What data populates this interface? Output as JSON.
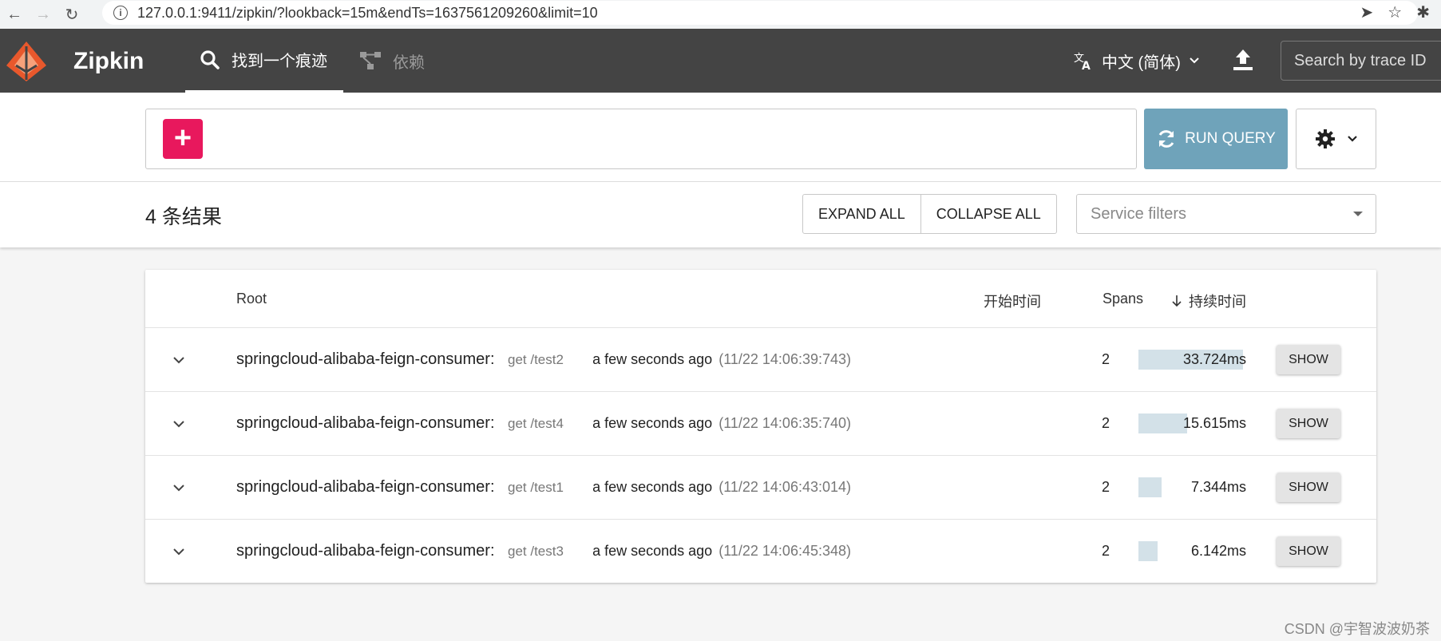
{
  "browser": {
    "url": "127.0.0.1:9411/zipkin/?lookback=15m&endTs=1637561209260&limit=10"
  },
  "header": {
    "brand": "Zipkin",
    "tab_find": "找到一个痕迹",
    "tab_dependencies": "依赖",
    "language": "中文 (简体)",
    "trace_search_placeholder": "Search by trace ID"
  },
  "query": {
    "run_label": "RUN QUERY"
  },
  "results": {
    "count_label": "4 条结果",
    "expand_all": "EXPAND ALL",
    "collapse_all": "COLLAPSE ALL",
    "service_filters_placeholder": "Service filters"
  },
  "table": {
    "columns": {
      "root": "Root",
      "start_time": "开始时间",
      "spans": "Spans",
      "duration": "持续时间"
    },
    "show_label": "SHOW",
    "rows": [
      {
        "service": "springcloud-alibaba-feign-consumer:",
        "operation": "get /test2",
        "ago": "a few seconds ago",
        "timestamp": "(11/22 14:06:39:743)",
        "spans": "2",
        "duration": "33.724ms",
        "duration_fraction": 1.0
      },
      {
        "service": "springcloud-alibaba-feign-consumer:",
        "operation": "get /test4",
        "ago": "a few seconds ago",
        "timestamp": "(11/22 14:06:35:740)",
        "spans": "2",
        "duration": "15.615ms",
        "duration_fraction": 0.463
      },
      {
        "service": "springcloud-alibaba-feign-consumer:",
        "operation": "get /test1",
        "ago": "a few seconds ago",
        "timestamp": "(11/22 14:06:43:014)",
        "spans": "2",
        "duration": "7.344ms",
        "duration_fraction": 0.218
      },
      {
        "service": "springcloud-alibaba-feign-consumer:",
        "operation": "get /test3",
        "ago": "a few seconds ago",
        "timestamp": "(11/22 14:06:45:348)",
        "spans": "2",
        "duration": "6.142ms",
        "duration_fraction": 0.182
      }
    ]
  },
  "watermark": "CSDN @宇智波波奶茶",
  "colors": {
    "header_bg": "#444444",
    "add_button": "#e8185d",
    "run_button": "#6fa3ba",
    "duration_bar": "#d3e1e8"
  }
}
